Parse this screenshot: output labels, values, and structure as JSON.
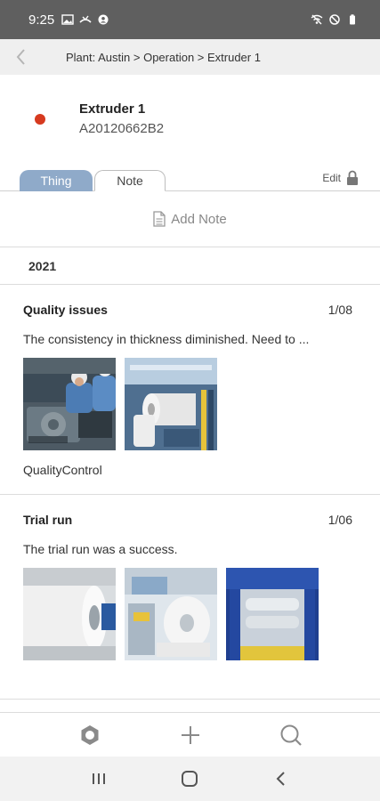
{
  "status_bar": {
    "time": "9:25",
    "left_icons": [
      "image-icon",
      "missed-call-icon",
      "account-circle-icon"
    ],
    "right_icons": [
      "wifi-off-icon",
      "do-not-disturb-icon",
      "battery-icon"
    ]
  },
  "header": {
    "back_icon": "chevron-left-icon",
    "breadcrumb": "Plant: Austin > Operation > Extruder 1"
  },
  "thing": {
    "name": "Extruder 1",
    "id": "A20120662B2",
    "status_color": "#d63a1f"
  },
  "tabs": [
    {
      "label": "Thing",
      "active": false
    },
    {
      "label": "Note",
      "active": true
    }
  ],
  "edit": {
    "label": "Edit",
    "icon": "lock-icon"
  },
  "add_note": {
    "label": "Add Note",
    "icon": "document-icon"
  },
  "year": "2021",
  "notes": [
    {
      "title": "Quality issues",
      "date": "1/08",
      "text": "The consistency in thickness diminished.  Need to ...",
      "tag": "QualityControl",
      "images": [
        "workers-at-machine-photo",
        "film-roll-machine-photo"
      ]
    },
    {
      "title": "Trial run",
      "date": "1/06",
      "text": "The trial run was a success.",
      "tag": "",
      "images": [
        "plastic-roll-photo",
        "film-production-photo",
        "blue-extruder-machine-photo"
      ]
    }
  ],
  "bottom_nav": {
    "icons": [
      "settings-icon",
      "add-icon",
      "search-icon"
    ]
  },
  "system_nav": {
    "icons": [
      "recent-apps-icon",
      "home-icon",
      "back-icon"
    ]
  },
  "colors": {
    "accent": "#8faac9",
    "status_bar": "#5f5f5f",
    "header_bg": "#efefef"
  }
}
